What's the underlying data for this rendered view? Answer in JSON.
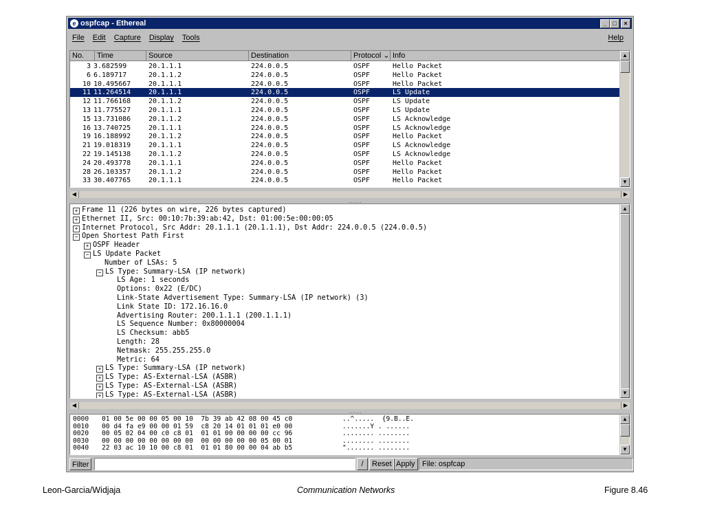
{
  "window": {
    "title": "ospfcap - Ethereal",
    "icon": "ethereal-icon",
    "controls": {
      "minimize": "_",
      "maximize": "□",
      "close": "×"
    }
  },
  "menu": {
    "items": [
      "File",
      "Edit",
      "Capture",
      "Display",
      "Tools"
    ],
    "help": "Help"
  },
  "packet_list": {
    "columns": [
      "No.",
      "Time",
      "Source",
      "Destination",
      "Protocol",
      "Info"
    ],
    "sort_indicator": "⌄",
    "selected_index": 3,
    "rows": [
      {
        "no": "3",
        "time": "3.682599",
        "src": "20.1.1.1",
        "dst": "224.0.0.5",
        "proto": "OSPF",
        "info": "Hello Packet"
      },
      {
        "no": "6",
        "time": "6.189717",
        "src": "20.1.1.2",
        "dst": "224.0.0.5",
        "proto": "OSPF",
        "info": "Hello Packet"
      },
      {
        "no": "10",
        "time": "10.495667",
        "src": "20.1.1.1",
        "dst": "224.0.0.5",
        "proto": "OSPF",
        "info": "Hello Packet"
      },
      {
        "no": "11",
        "time": "11.264514",
        "src": "20.1.1.1",
        "dst": "224.0.0.5",
        "proto": "OSPF",
        "info": "LS Update"
      },
      {
        "no": "12",
        "time": "11.766168",
        "src": "20.1.1.2",
        "dst": "224.0.0.5",
        "proto": "OSPF",
        "info": "LS Update"
      },
      {
        "no": "13",
        "time": "11.775527",
        "src": "20.1.1.1",
        "dst": "224.0.0.5",
        "proto": "OSPF",
        "info": "LS Update"
      },
      {
        "no": "15",
        "time": "13.731086",
        "src": "20.1.1.2",
        "dst": "224.0.0.5",
        "proto": "OSPF",
        "info": "LS Acknowledge"
      },
      {
        "no": "16",
        "time": "13.740725",
        "src": "20.1.1.1",
        "dst": "224.0.0.5",
        "proto": "OSPF",
        "info": "LS Acknowledge"
      },
      {
        "no": "19",
        "time": "16.188992",
        "src": "20.1.1.2",
        "dst": "224.0.0.5",
        "proto": "OSPF",
        "info": "Hello Packet"
      },
      {
        "no": "21",
        "time": "19.018319",
        "src": "20.1.1.1",
        "dst": "224.0.0.5",
        "proto": "OSPF",
        "info": "LS Acknowledge"
      },
      {
        "no": "22",
        "time": "19.145138",
        "src": "20.1.1.2",
        "dst": "224.0.0.5",
        "proto": "OSPF",
        "info": "LS Acknowledge"
      },
      {
        "no": "24",
        "time": "20.493778",
        "src": "20.1.1.1",
        "dst": "224.0.0.5",
        "proto": "OSPF",
        "info": "Hello Packet"
      },
      {
        "no": "28",
        "time": "26.103357",
        "src": "20.1.1.2",
        "dst": "224.0.0.5",
        "proto": "OSPF",
        "info": "Hello Packet"
      },
      {
        "no": "33",
        "time": "30.407765",
        "src": "20.1.1.1",
        "dst": "224.0.0.5",
        "proto": "OSPF",
        "info": "Hello Packet"
      }
    ]
  },
  "tree": {
    "lines": [
      {
        "indent": 0,
        "toggle": "⊞",
        "text": "Frame 11 (226 bytes on wire, 226 bytes captured)"
      },
      {
        "indent": 0,
        "toggle": "⊞",
        "text": "Ethernet II, Src: 00:10:7b:39:ab:42, Dst: 01:00:5e:00:00:05"
      },
      {
        "indent": 0,
        "toggle": "⊞",
        "text": "Internet Protocol, Src Addr: 20.1.1.1 (20.1.1.1), Dst Addr: 224.0.0.5 (224.0.0.5)"
      },
      {
        "indent": 0,
        "toggle": "⊟",
        "text": "Open Shortest Path First"
      },
      {
        "indent": 1,
        "toggle": "⊞",
        "text": "OSPF Header"
      },
      {
        "indent": 1,
        "toggle": "⊟",
        "text": "LS Update Packet"
      },
      {
        "indent": 2,
        "toggle": "",
        "text": "Number of LSAs: 5"
      },
      {
        "indent": 2,
        "toggle": "⊟",
        "text": "LS Type: Summary-LSA (IP network)"
      },
      {
        "indent": 3,
        "toggle": "",
        "text": "LS Age: 1 seconds"
      },
      {
        "indent": 3,
        "toggle": "",
        "text": "Options: 0x22 (E/DC)"
      },
      {
        "indent": 3,
        "toggle": "",
        "text": "Link-State Advertisement Type: Summary-LSA (IP network) (3)"
      },
      {
        "indent": 3,
        "toggle": "",
        "text": "Link State ID: 172.16.16.0"
      },
      {
        "indent": 3,
        "toggle": "",
        "text": "Advertising Router: 200.1.1.1 (200.1.1.1)"
      },
      {
        "indent": 3,
        "toggle": "",
        "text": "LS Sequence Number: 0x80000004"
      },
      {
        "indent": 3,
        "toggle": "",
        "text": "LS Checksum: abb5"
      },
      {
        "indent": 3,
        "toggle": "",
        "text": "Length: 28"
      },
      {
        "indent": 3,
        "toggle": "",
        "text": "Netmask: 255.255.255.0"
      },
      {
        "indent": 3,
        "toggle": "",
        "text": "Metric: 64"
      },
      {
        "indent": 2,
        "toggle": "⊞",
        "text": "LS Type: Summary-LSA (IP network)"
      },
      {
        "indent": 2,
        "toggle": "⊞",
        "text": "LS Type: AS-External-LSA (ASBR)"
      },
      {
        "indent": 2,
        "toggle": "⊞",
        "text": "LS Type: AS-External-LSA (ASBR)"
      },
      {
        "indent": 2,
        "toggle": "⊞",
        "text": "LS Type: AS-External-LSA (ASBR)"
      }
    ]
  },
  "hex_dump": {
    "lines": [
      {
        "offset": "0000",
        "bytes": "01 00 5e 00 00 05 00 10  7b 39 ab 42 08 00 45 c0",
        "ascii": "..^.....  {9.B..E."
      },
      {
        "offset": "0010",
        "bytes": "00 d4 fa e9 00 00 01 59  c8 20 14 01 01 01 e0 00",
        "ascii": ".......Y . ......"
      },
      {
        "offset": "0020",
        "bytes": "00 05 02 04 00 c0 c8 01  01 01 00 00 00 00 cc 96",
        "ascii": "........ ........"
      },
      {
        "offset": "0030",
        "bytes": "00 00 00 00 00 00 00 00  00 00 00 00 00 05 00 01",
        "ascii": "........ ........"
      },
      {
        "offset": "0040",
        "bytes": "22 03 ac 10 10 00 c8 01  01 01 80 00 00 04 ab b5",
        "ascii": "\"....... ........"
      }
    ]
  },
  "statusbar": {
    "filter_label": "Filter",
    "filter_value": "",
    "edit_glyph": "/",
    "reset_label": "Reset",
    "apply_label": "Apply",
    "file_label": "File: ospfcap"
  },
  "pane_grip": "......",
  "footer": {
    "left": "Leon-Garcia/Widjaja",
    "center": "Communication Networks",
    "right": "Figure 8.46"
  }
}
